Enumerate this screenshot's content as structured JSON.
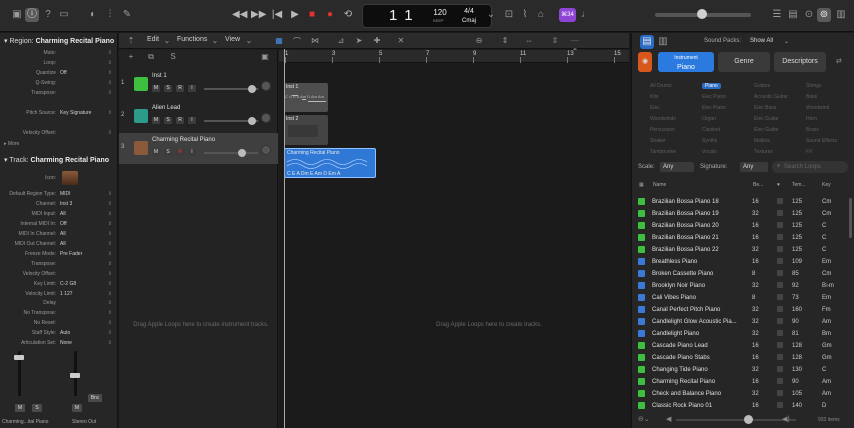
{
  "transport": {
    "bar": "1",
    "beat": "1",
    "tempo": "120",
    "tempo_sub": "KEEP",
    "time_sig": "4/4",
    "key": "Cmaj",
    "count_badge": "⌘34"
  },
  "inspector": {
    "region_header": "Region:",
    "region_name": "Charming Recital Piano",
    "region_rows": [
      {
        "label": "Mute:",
        "value": ""
      },
      {
        "label": "Loop:",
        "value": ""
      },
      {
        "label": "Quantize",
        "value": "Off"
      },
      {
        "label": "Q-Swing:",
        "value": ""
      },
      {
        "label": "Transpose:",
        "value": ""
      },
      {
        "label": "Pitch Source:",
        "value": "Key Signature"
      },
      {
        "label": "Velocity Offset:",
        "value": ""
      }
    ],
    "more_label": "More",
    "track_header": "Track:",
    "track_name": "Charming Recital Piano",
    "icon_label": "Icon:",
    "track_rows": [
      {
        "label": "Default Region Type:",
        "value": "MIDI"
      },
      {
        "label": "Channel:",
        "value": "Inst 3"
      },
      {
        "label": "MIDI Input:",
        "value": "All"
      },
      {
        "label": "Internal MIDI In:",
        "value": "Off"
      },
      {
        "label": "MIDI In Channel:",
        "value": "All"
      },
      {
        "label": "MIDI Out Channel:",
        "value": "All"
      },
      {
        "label": "Freeze Mode:",
        "value": "Pre Fader"
      },
      {
        "label": "Transpose:",
        "value": ""
      },
      {
        "label": "Velocity Offset:",
        "value": ""
      },
      {
        "label": "Key Limit:",
        "value": "C-2 G8"
      },
      {
        "label": "Velocity Limit:",
        "value": "1 127"
      },
      {
        "label": "Delay",
        "value": ""
      },
      {
        "label": "No Transpose:",
        "value": ""
      },
      {
        "label": "No Reset:",
        "value": ""
      },
      {
        "label": "Staff Style:",
        "value": "Auto"
      },
      {
        "label": "Articulation Set:",
        "value": "None"
      }
    ],
    "strip1_name": "Charming...ital Piano",
    "strip2_name": "Stereo Out",
    "bnc_label": "Bnc",
    "mute_label": "M",
    "solo_label": "S"
  },
  "toolbar": {
    "edit": "Edit",
    "functions": "Functions",
    "view": "View"
  },
  "track_list_toolbar": {
    "add": "+",
    "s": "S"
  },
  "tracks": [
    {
      "num": "1",
      "name": "Inst 1",
      "color": "#3fbf3f",
      "vol": 0.88
    },
    {
      "num": "2",
      "name": "Alien Lead",
      "color": "#2d9a8a",
      "vol": 0.88
    },
    {
      "num": "3",
      "name": "Charming Recital Piano",
      "color": "#8a5a3a",
      "vol": 0.7
    }
  ],
  "track_buttons": {
    "m": "M",
    "s": "S",
    "r": "R",
    "i": "I"
  },
  "ruler": [
    "1",
    "3",
    "5",
    "7",
    "9",
    "11",
    "13",
    "15"
  ],
  "regions": [
    {
      "name": "Inst 1",
      "chords": "",
      "color": "#5a5a5a"
    },
    {
      "name": "Inst 2",
      "chords": "",
      "color": "#4a4a4a"
    },
    {
      "name": "Charming Recital Piano",
      "chords": "C  E  A  Dm  E  Am  D  Em  A",
      "color": "#2f78d6"
    }
  ],
  "loop_chords": "C  G  E  A  Am  D  Am  Am",
  "empty_left": "Drag Apple Loops here to create instrument tracks.",
  "empty_right": "Drag Apple Loops here to create tracks.",
  "library": {
    "sound_packs_label": "Sound Packs:",
    "sound_packs_value": "Show All",
    "tab_instrument_top": "Instrument",
    "tab_instrument_bottom": "Piano",
    "tab_genre": "Genre",
    "tab_descriptors": "Descriptors",
    "filters": [
      [
        "All Drums",
        "Piano",
        "Guitars",
        "Strings"
      ],
      [
        "Kits",
        "Elec Piano",
        "Acoustic Guitar",
        "Bass"
      ],
      [
        "Elec",
        "Elec Piano",
        "Elec Bass",
        "Woodwind"
      ],
      [
        "Woodwinds",
        "Organ",
        "Elec Guitar",
        "Horn"
      ],
      [
        "Percussion",
        "Clavinet",
        "Elec Guitar",
        "Brass"
      ],
      [
        "Shaker",
        "Synths",
        "Mallets",
        "Sound Effects"
      ],
      [
        "Tambourine",
        "Vocals",
        "Textures",
        "FX"
      ]
    ],
    "scale_label": "Scale:",
    "scale_value": "Any",
    "sig_label": "Signature:",
    "sig_value": "Any",
    "search_placeholder": "Search Loops",
    "col_name": "Name",
    "col_beats": "Be...",
    "col_tempo": "Tem...",
    "col_key": "Key",
    "rows": [
      {
        "name": "Brazilian Bossa Piano 18",
        "beats": "16",
        "tempo": "125",
        "key": "Cm",
        "icon": "#3fbf3f"
      },
      {
        "name": "Brazilian Bossa Piano 19",
        "beats": "32",
        "tempo": "125",
        "key": "Cm",
        "icon": "#3fbf3f"
      },
      {
        "name": "Brazilian Bossa Piano 20",
        "beats": "16",
        "tempo": "125",
        "key": "C",
        "icon": "#3fbf3f"
      },
      {
        "name": "Brazilian Bossa Piano 21",
        "beats": "16",
        "tempo": "125",
        "key": "C",
        "icon": "#3fbf3f"
      },
      {
        "name": "Brazilian Bossa Piano 22",
        "beats": "32",
        "tempo": "125",
        "key": "C",
        "icon": "#3fbf3f"
      },
      {
        "name": "Breathless Piano",
        "beats": "16",
        "tempo": "109",
        "key": "Em",
        "icon": "#3a7ad6"
      },
      {
        "name": "Broken Cassette Piano",
        "beats": "8",
        "tempo": "85",
        "key": "Cm",
        "icon": "#3a7ad6"
      },
      {
        "name": "Brooklyn Noir Piano",
        "beats": "32",
        "tempo": "92",
        "key": "B♭m",
        "icon": "#3a7ad6"
      },
      {
        "name": "Cali Vibes Piano",
        "beats": "8",
        "tempo": "73",
        "key": "Em",
        "icon": "#3a7ad6"
      },
      {
        "name": "Canal Perfect Pitch Piano",
        "beats": "32",
        "tempo": "160",
        "key": "Fm",
        "icon": "#3a7ad6"
      },
      {
        "name": "Candlelight Glow Acoustic Pia...",
        "beats": "32",
        "tempo": "90",
        "key": "Am",
        "icon": "#3a7ad6"
      },
      {
        "name": "Candlelight Piano",
        "beats": "32",
        "tempo": "81",
        "key": "Bm",
        "icon": "#3a7ad6"
      },
      {
        "name": "Cascade Piano Lead",
        "beats": "16",
        "tempo": "128",
        "key": "Gm",
        "icon": "#3fbf3f"
      },
      {
        "name": "Cascade Piano Stabs",
        "beats": "16",
        "tempo": "128",
        "key": "Gm",
        "icon": "#3fbf3f"
      },
      {
        "name": "Changing Tide Piano",
        "beats": "32",
        "tempo": "130",
        "key": "C",
        "icon": "#3fbf3f"
      },
      {
        "name": "Charming Recital Piano",
        "beats": "16",
        "tempo": "90",
        "key": "Am",
        "icon": "#3fbf3f"
      },
      {
        "name": "Check and Balance Piano",
        "beats": "32",
        "tempo": "105",
        "key": "Am",
        "icon": "#3fbf3f"
      },
      {
        "name": "Classic Rock Piano 01",
        "beats": "16",
        "tempo": "140",
        "key": "D",
        "icon": "#3fbf3f"
      }
    ],
    "item_count": "933 items"
  }
}
